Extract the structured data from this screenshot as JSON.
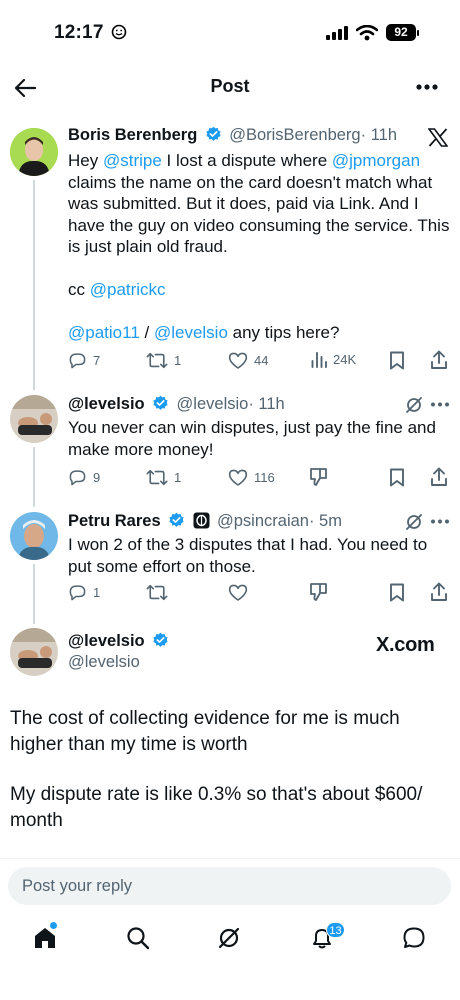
{
  "status_bar": {
    "time": "12:17",
    "battery": "92"
  },
  "header": {
    "title": "Post"
  },
  "tweets": [
    {
      "name": "Boris Berenberg",
      "handle": "@BorisBerenberg",
      "time": "· 11h",
      "lines": [
        [
          "Hey ",
          "@stripe",
          " I lost a dispute where ",
          "@jpmorgan"
        ],
        "claims the name on the card doesn't match what",
        "was submitted. But it does, paid via Link. And I",
        "have the guy on video consuming the service. This",
        "is just plain old fraud."
      ],
      "cc": "cc ",
      "cc_mention": "@patrickc",
      "tips_mention1": "@patio11",
      "tips_sep": " / ",
      "tips_mention2": "@levelsio",
      "tips_text": " any tips here?",
      "replies": "7",
      "reposts": "1",
      "likes": "44",
      "views": "24K"
    },
    {
      "name": "@levelsio",
      "handle": "@levelsio",
      "time": "· 11h",
      "line1": "You never can win disputes, just pay the fine and",
      "line2": "make more money!",
      "replies": "9",
      "reposts": "1",
      "likes": "116"
    },
    {
      "name": "Petru Rares",
      "handle": "@psincraian",
      "time": "· 5m",
      "line1": "I won 2 of the 3 disputes that I had. You need to",
      "line2": "put some effort on those.",
      "replies": "1"
    }
  ],
  "watermark": "X.com",
  "quote_author": {
    "name": "@levelsio",
    "handle": "@levelsio"
  },
  "quote": {
    "p1_line1": "The cost of collecting evidence for me is much",
    "p1_line2": "higher than my time is worth",
    "p2_line1": "My dispute rate is like 0.3% so that's about $600/",
    "p2_line2": "month"
  },
  "reply_bar": {
    "placeholder": "Post your reply"
  },
  "tab_bar": {
    "notifications_badge": "13"
  },
  "colors": {
    "accent": "#1d9bf0",
    "text": "#0f1419",
    "muted": "#536471"
  },
  "icons": [
    "back-arrow-icon",
    "more-icon",
    "x-logo-icon",
    "verified-icon",
    "reply-icon",
    "repost-icon",
    "like-icon",
    "views-icon",
    "bookmark-icon",
    "share-icon",
    "grok-icon",
    "downvote-icon",
    "home-icon",
    "search-icon",
    "notifications-icon",
    "messages-icon"
  ]
}
